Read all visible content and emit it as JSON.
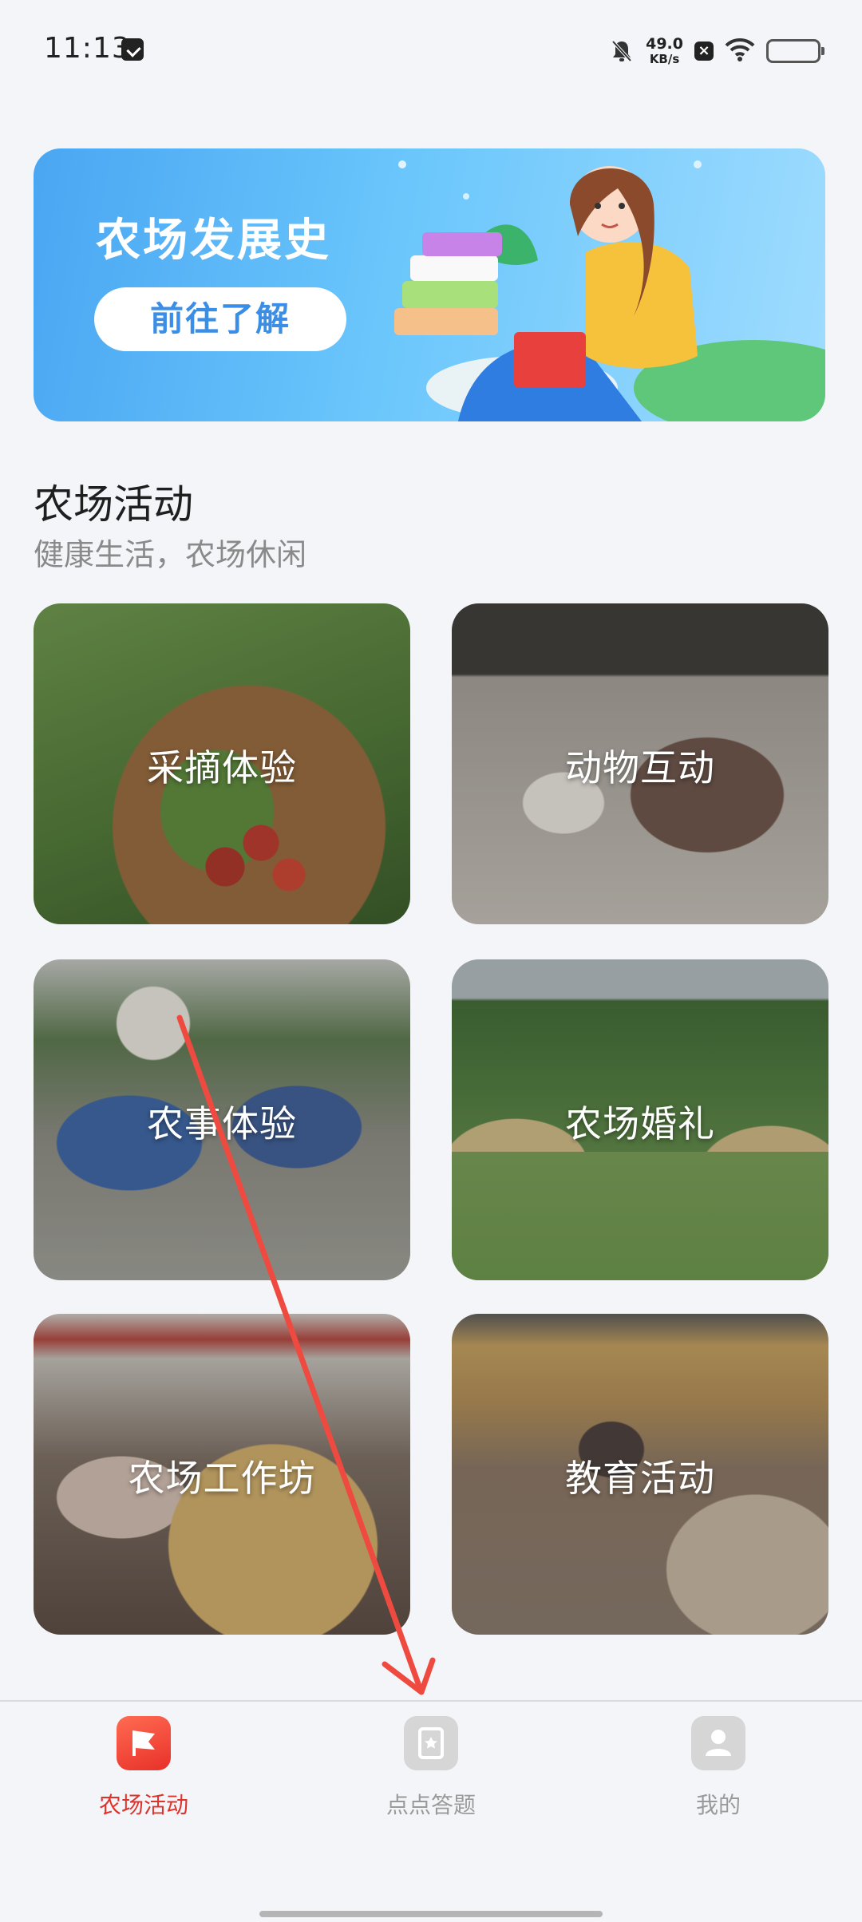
{
  "status_bar": {
    "time": "11:13",
    "net_speed_value": "49.0",
    "net_speed_unit": "KB/s"
  },
  "banner": {
    "title": "农场发展史",
    "button_label": "前往了解"
  },
  "section": {
    "title": "农场活动",
    "subtitle": "健康生活，农场休闲"
  },
  "activities": [
    {
      "label": "采摘体验"
    },
    {
      "label": "动物互动"
    },
    {
      "label": "农事体验"
    },
    {
      "label": "农场婚礼"
    },
    {
      "label": "农场工作坊"
    },
    {
      "label": "教育活动"
    }
  ],
  "bottom_nav": {
    "items": [
      {
        "label": "农场活动",
        "icon": "flag-icon",
        "active": true
      },
      {
        "label": "点点答题",
        "icon": "star-card-icon",
        "active": false
      },
      {
        "label": "我的",
        "icon": "person-icon",
        "active": false
      }
    ]
  },
  "colors": {
    "accent": "#e0322a",
    "banner_blue": "#4aa6f2",
    "overlay_arrow": "#ef4a40"
  }
}
